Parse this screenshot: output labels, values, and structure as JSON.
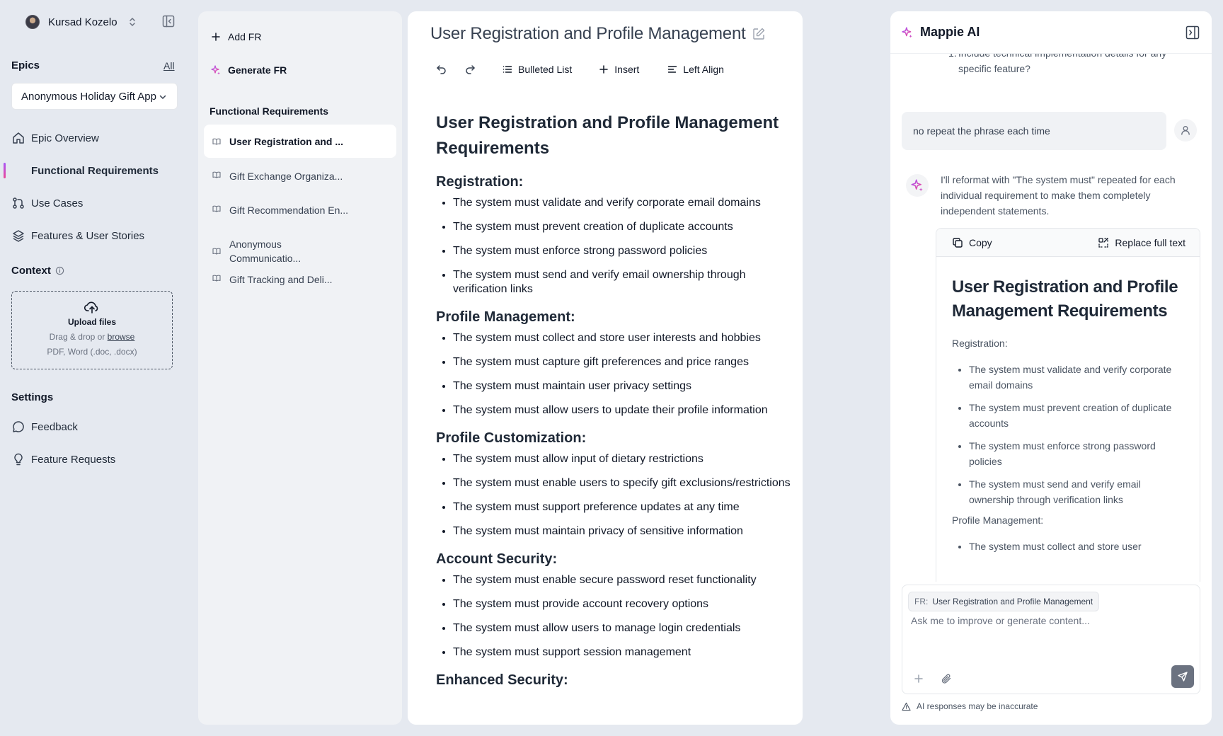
{
  "user": {
    "name": "Kursad Kozelo"
  },
  "epics": {
    "label": "Epics",
    "all_link": "All",
    "selected": "Anonymous Holiday Gift App"
  },
  "nav": {
    "epic_overview": "Epic Overview",
    "functional_requirements": "Functional Requirements",
    "use_cases": "Use Cases",
    "features": "Features & User Stories"
  },
  "context": {
    "label": "Context",
    "upload_title": "Upload files",
    "upload_hint_prefix": "Drag & drop or",
    "upload_browse": "browse",
    "upload_types": "PDF, Word (.doc, .docx)"
  },
  "settings": {
    "label": "Settings",
    "feedback": "Feedback",
    "feature_requests": "Feature Requests"
  },
  "fr_panel": {
    "add_fr": "Add FR",
    "generate_fr": "Generate FR",
    "heading": "Functional Requirements",
    "items": [
      "User Registration and ...",
      "Gift Exchange Organiza...",
      "Gift Recommendation En...",
      "Anonymous Communicatio...",
      "Gift Tracking and Deli..."
    ]
  },
  "editor": {
    "title": "User Registration and Profile Management",
    "toolbar": {
      "bulleted_list": "Bulleted List",
      "insert": "Insert",
      "left_align": "Left Align"
    },
    "doc_title": "User Registration and Profile Management Requirements",
    "sections": [
      {
        "heading": "Registration:",
        "items": [
          "The system must validate and verify corporate email domains",
          "The system must prevent creation of duplicate accounts",
          "The system must enforce strong password policies",
          "The system must send and verify email ownership through verification links"
        ]
      },
      {
        "heading": "Profile Management:",
        "items": [
          "The system must collect and store user interests and hobbies",
          "The system must capture gift preferences and price ranges",
          "The system must maintain user privacy settings",
          "The system must allow users to update their profile information"
        ]
      },
      {
        "heading": "Profile Customization:",
        "items": [
          "The system must allow input of dietary restrictions",
          "The system must enable users to specify gift exclusions/restrictions",
          "The system must support preference updates at any time",
          "The system must maintain privacy of sensitive information"
        ]
      },
      {
        "heading": "Account Security:",
        "items": [
          "The system must enable secure password reset functionality",
          "The system must provide account recovery options",
          "The system must allow users to manage login credentials",
          "The system must support session management"
        ]
      },
      {
        "heading": "Enhanced Security:",
        "items": []
      }
    ]
  },
  "ai": {
    "title": "Mappie AI",
    "prev_num": "1.",
    "prev_text": "Include technical implementation details for any specific feature?",
    "user_message": "no repeat the phrase each time",
    "reply": "I'll reformat with \"The system must\" repeated for each individual requirement to make them completely independent statements.",
    "copy_label": "Copy",
    "replace_label": "Replace full text",
    "card_title": "User Registration and Profile Management Requirements",
    "card_section_1": "Registration:",
    "card_items": [
      "The system must validate and verify corporate email domains",
      "The system must prevent creation of duplicate accounts",
      "The system must enforce strong password policies",
      "The system must send and verify email ownership through verification links"
    ],
    "card_section_2": "Profile Management:",
    "card_items_2": [
      "The system must collect and store user"
    ],
    "chip_key": "FR:",
    "chip_value": "User Registration and Profile Management",
    "input_placeholder": "Ask me to improve or generate content...",
    "disclaimer": "AI responses may be inaccurate"
  }
}
